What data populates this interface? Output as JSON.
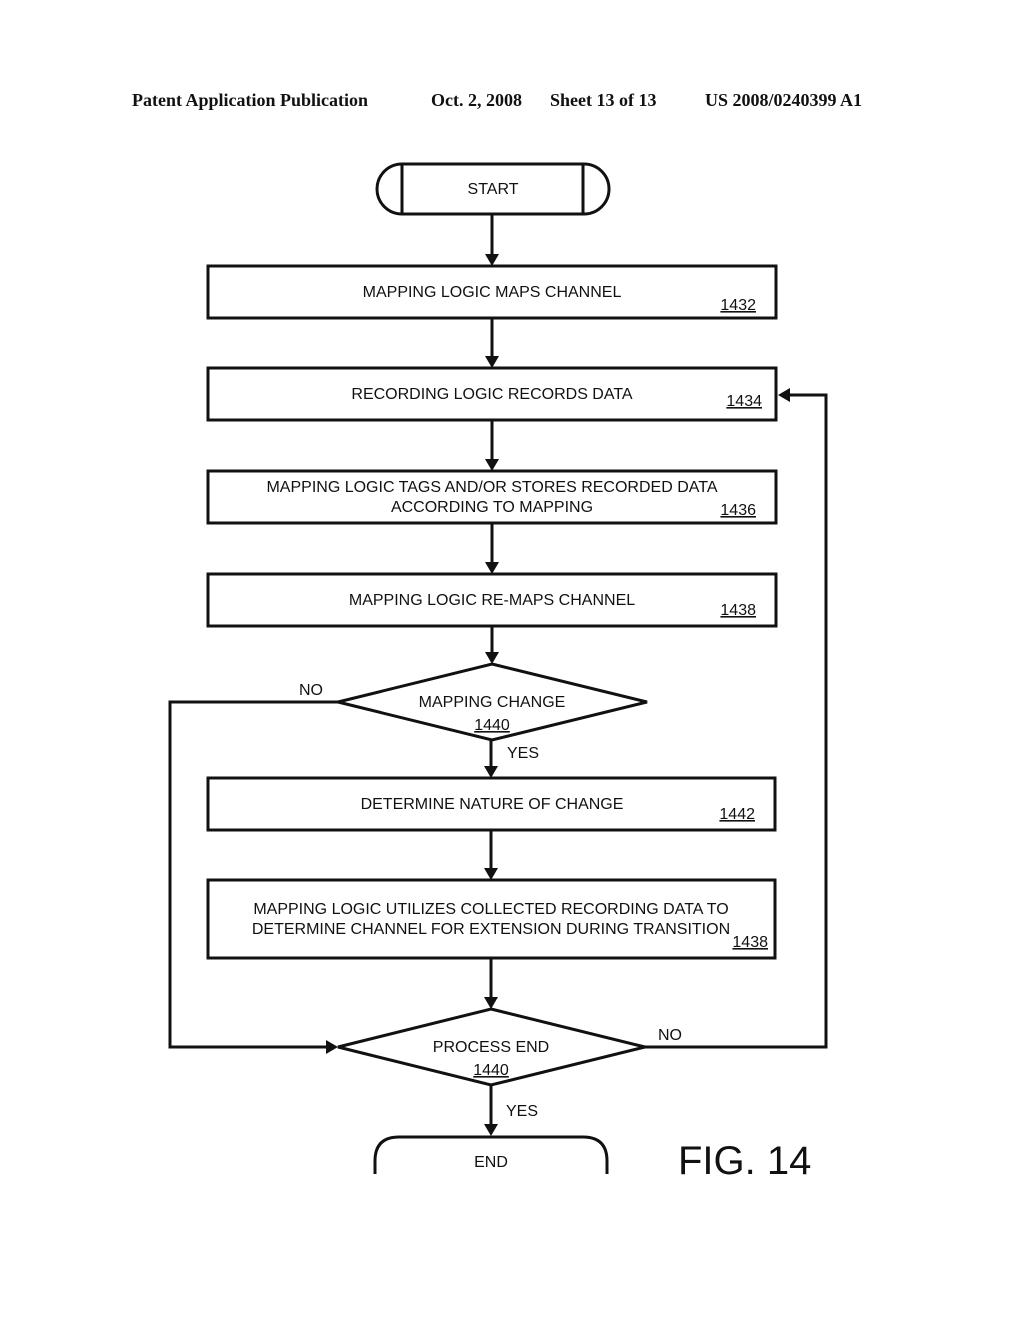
{
  "header": {
    "publication": "Patent Application Publication",
    "date": "Oct. 2, 2008",
    "sheet": "Sheet 13 of 13",
    "number": "US 2008/0240399 A1"
  },
  "flowchart": {
    "start": "START",
    "end": "END",
    "steps": [
      {
        "lines": [
          "MAPPING LOGIC MAPS CHANNEL"
        ],
        "ref": "1432"
      },
      {
        "lines": [
          "RECORDING LOGIC RECORDS DATA"
        ],
        "ref": "1434"
      },
      {
        "lines": [
          "MAPPING LOGIC TAGS AND/OR STORES RECORDED DATA",
          "ACCORDING TO MAPPING"
        ],
        "ref": "1436"
      },
      {
        "lines": [
          "MAPPING LOGIC RE-MAPS CHANNEL"
        ],
        "ref": "1438"
      },
      {
        "lines": [
          "DETERMINE NATURE OF CHANGE"
        ],
        "ref": "1442"
      },
      {
        "lines": [
          "MAPPING LOGIC UTILIZES COLLECTED RECORDING DATA TO",
          "DETERMINE CHANNEL FOR EXTENSION DURING TRANSITION"
        ],
        "ref": "1438"
      }
    ],
    "decisions": [
      {
        "label": "MAPPING CHANGE",
        "ref": "1440",
        "yes": "YES",
        "no": "NO"
      },
      {
        "label": "PROCESS END",
        "ref": "1440",
        "yes": "YES",
        "no": "NO"
      }
    ],
    "figure_label": "FIG. 14"
  }
}
